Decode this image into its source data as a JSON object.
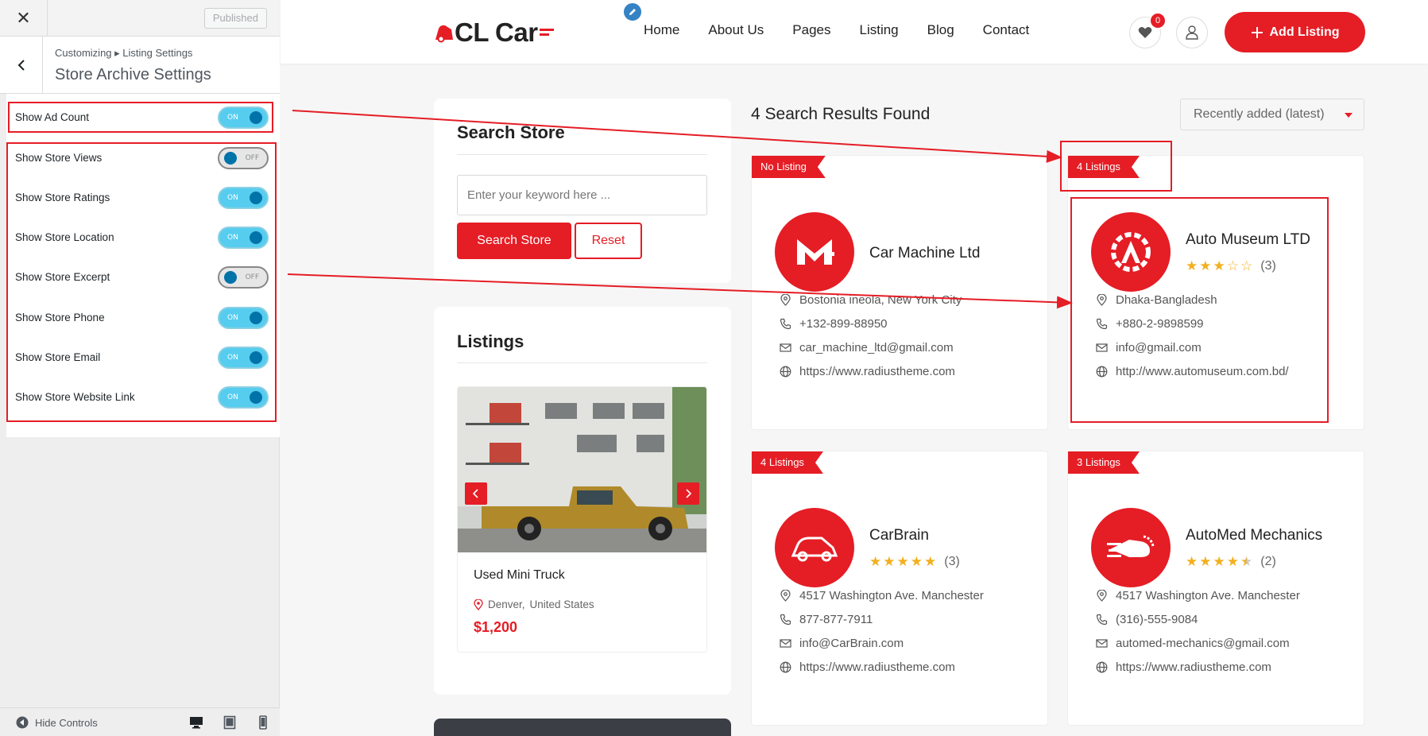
{
  "sidebar": {
    "published_label": "Published",
    "breadcrumb": "Customizing ▸ Listing Settings",
    "section_title": "Store Archive Settings",
    "settings": [
      {
        "label": "Show Ad Count",
        "state": "ON"
      },
      {
        "label": "Show Store Views",
        "state": "OFF"
      },
      {
        "label": "Show Store Ratings",
        "state": "ON"
      },
      {
        "label": "Show Store Location",
        "state": "ON"
      },
      {
        "label": "Show Store Excerpt",
        "state": "OFF"
      },
      {
        "label": "Show Store Phone",
        "state": "ON"
      },
      {
        "label": "Show Store Email",
        "state": "ON"
      },
      {
        "label": "Show Store Website Link",
        "state": "ON"
      }
    ],
    "hide_controls_label": "Hide Controls"
  },
  "header": {
    "logo_text": "CL Car",
    "nav": [
      "Home",
      "About Us",
      "Pages",
      "Listing",
      "Blog",
      "Contact"
    ],
    "favorites_count": "0",
    "add_listing_label": "Add Listing"
  },
  "search_card": {
    "title": "Search Store",
    "placeholder": "Enter your keyword here ...",
    "search_label": "Search Store",
    "reset_label": "Reset"
  },
  "listings_card": {
    "title": "Listings",
    "item": {
      "title": "Used Mini Truck",
      "city": "Denver,",
      "country": "United States",
      "price": "$1,200"
    }
  },
  "results": {
    "count_text": "4 Search Results Found",
    "sort_value": "Recently added (latest)",
    "stores": [
      {
        "ribbon": "No Listing",
        "name": "Car Machine Ltd",
        "rating": null,
        "rating_text": "",
        "address": "Bostonia ineola, New York City",
        "phone": "+132-899-88950",
        "email": "car_machine_ltd@gmail.com",
        "website": "https://www.radiustheme.com"
      },
      {
        "ribbon": "4 Listings",
        "name": "Auto Museum LTD",
        "rating": 3,
        "rating_text": "(3)",
        "address": "Dhaka-Bangladesh",
        "phone": "+880-2-9898599",
        "email": "info@gmail.com",
        "website": "http://www.automuseum.com.bd/"
      },
      {
        "ribbon": "4 Listings",
        "name": "CarBrain",
        "rating": 5,
        "rating_text": "(3)",
        "address": "4517 Washington Ave. Manchester",
        "phone": "877-877-7911",
        "email": "info@CarBrain.com",
        "website": "https://www.radiustheme.com"
      },
      {
        "ribbon": "3 Listings",
        "name": "AutoMed Mechanics",
        "rating": 4.5,
        "rating_text": "(2)",
        "address": "4517 Washington Ave. Manchester",
        "phone": "(316)-555-9084",
        "email": "automed-mechanics@gmail.com",
        "website": "https://www.radiustheme.com"
      }
    ]
  },
  "colors": {
    "brand_red": "#e51d25",
    "toggle_on": "#56cdef",
    "toggle_knob": "#0073a8",
    "star": "#f2b01e"
  },
  "icons": [
    "close-icon",
    "chevron-left-icon",
    "pencil-icon",
    "heart-icon",
    "user-icon",
    "plus-icon",
    "map-pin-icon",
    "phone-icon",
    "mail-icon",
    "globe-icon",
    "star-icon",
    "desktop-icon",
    "tablet-icon",
    "mobile-icon"
  ]
}
